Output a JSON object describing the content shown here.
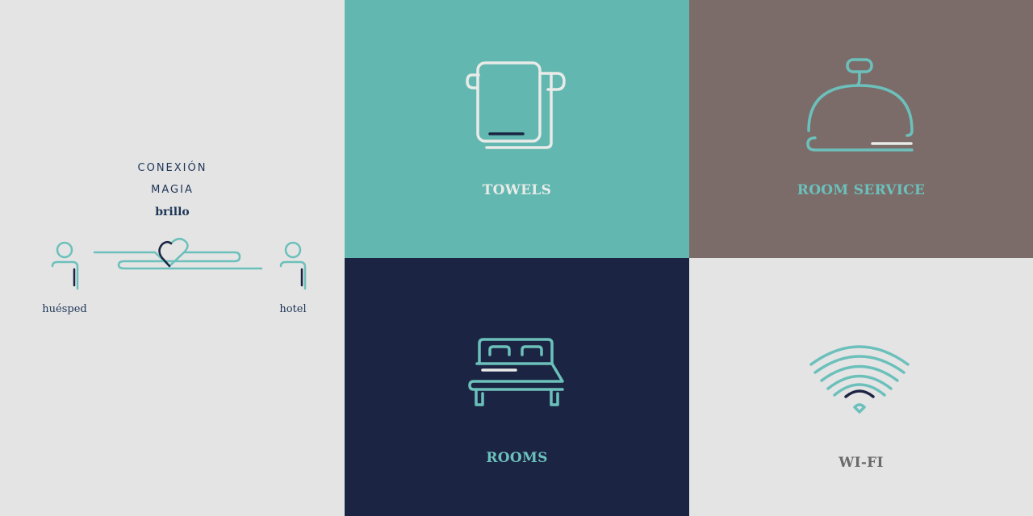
{
  "colors": {
    "teal": "#62b8b0",
    "teal_stroke": "#6cc0bb",
    "navy": "#1b2543",
    "navy_text": "#1d3557",
    "taupe": "#7b6c69",
    "light_gray": "#e4e4e4",
    "off_white": "#e9ebe9",
    "wifi_label": "#6a6a6a"
  },
  "left": {
    "words": [
      "CONEXIÓN",
      "MAGIA",
      "brillo"
    ],
    "guest_label": "huésped",
    "hotel_label": "hotel",
    "icons": [
      "guest-person-icon",
      "heart-line-icon",
      "hotel-person-icon"
    ]
  },
  "tiles": {
    "towels": {
      "label": "TOWELS",
      "icon": "towel-icon"
    },
    "room_service": {
      "label": "ROOM SERVICE",
      "icon": "service-bell-icon"
    },
    "rooms": {
      "label": "ROOMS",
      "icon": "bed-icon"
    },
    "wifi": {
      "label": "WI-FI",
      "icon": "wifi-icon"
    }
  }
}
